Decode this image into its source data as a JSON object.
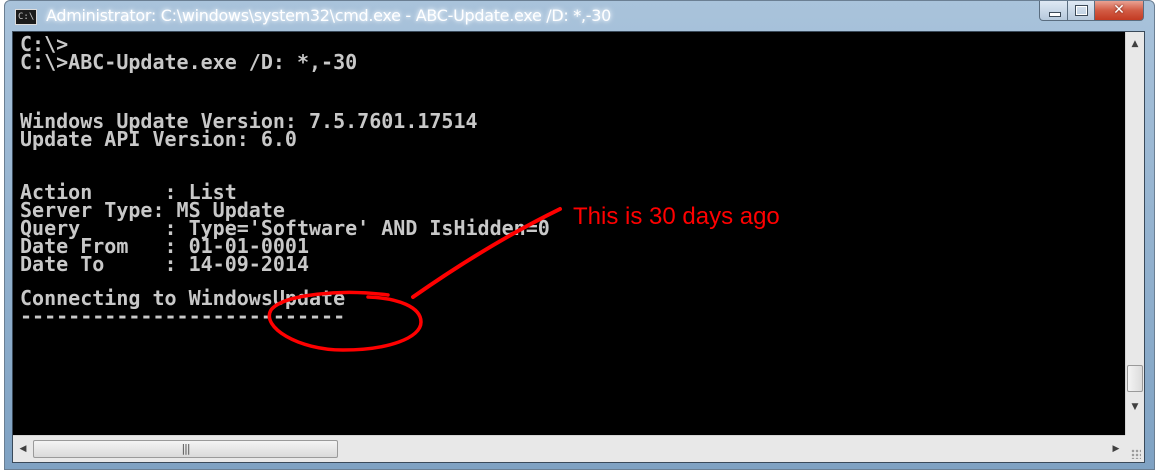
{
  "window": {
    "title": "Administrator: C:\\windows\\system32\\cmd.exe - ABC-Update.exe  /D: *,-30",
    "app_icon_label": "C:\\",
    "app_icon": "cmd-icon",
    "minimize_icon": "minimize-icon",
    "maximize_icon": "maximize-icon",
    "close_icon": "close-icon",
    "close_glyph": "✕"
  },
  "console": {
    "lines": [
      "C:\\>",
      "C:\\>ABC-Update.exe /D: *,-30",
      "",
      "Windows Update Version: 7.5.7601.17514",
      "Update API Version: 6.0",
      "",
      "Action      : List",
      "Server Type: MS Update",
      "Query       : Type='Software' AND IsHidden=0",
      "Date From   : 01-01-0001",
      "Date To     : 14-09-2014",
      "",
      "Connecting to WindowsUpdate",
      "---------------------------"
    ],
    "text_color": "#c8c8c8",
    "background_color": "#000000"
  },
  "annotation": {
    "text": "This is 30 days ago",
    "color": "#ff0000"
  },
  "scrollbars": {
    "up_arrow": "▲",
    "down_arrow": "▼",
    "left_arrow": "◀",
    "right_arrow": "▶",
    "thumb_grip": "|||"
  }
}
